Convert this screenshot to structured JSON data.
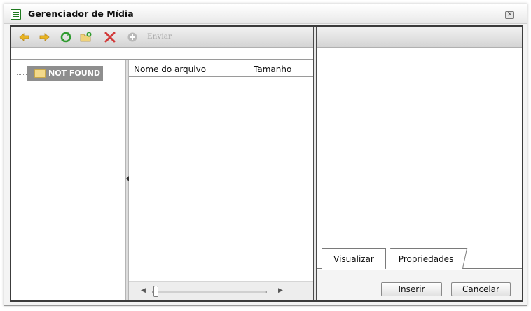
{
  "window": {
    "title": "Gerenciador de Mídia",
    "close_label": "✕"
  },
  "toolbar": {
    "icons": [
      "back-arrow-icon",
      "forward-arrow-icon",
      "refresh-icon",
      "new-folder-icon",
      "delete-icon",
      "upload-icon"
    ],
    "upload_label": "Enviar"
  },
  "tree": {
    "root_label": "NOT FOUND"
  },
  "files": {
    "columns": [
      "Nome do arquivo",
      "Tamanho"
    ],
    "zoom_left": "◀",
    "zoom_right": "▶"
  },
  "preview": {
    "tabs": [
      "Visualizar",
      "Propriedades"
    ]
  },
  "actions": {
    "insert_label": "Inserir",
    "cancel_label": "Cancelar"
  },
  "colors": {
    "accent_green": "#2e9a2e",
    "arrow_yellow": "#e8b423",
    "delete_red": "#d23a3a"
  }
}
